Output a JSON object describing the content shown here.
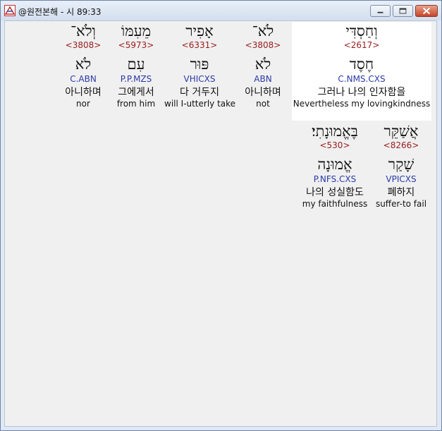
{
  "window": {
    "title": "@원전본해 - 시 89:33"
  },
  "rows": [
    {
      "words": [
        {
          "hebrew": "וְחַסְדִּי",
          "strong": "<2617>",
          "lemma": "חֶסֶד",
          "parse": "C.NMS.CXS",
          "korean": "그러나 나의 인자함을",
          "english": "Nevertheless my lovingkindness",
          "selected": true
        },
        {
          "hebrew": "לֹא־",
          "strong": "<3808>",
          "lemma": "לֹא",
          "parse": "ABN",
          "korean": "아니하며",
          "english": "not",
          "selected": false
        },
        {
          "hebrew": "אָפִיר",
          "strong": "<6331>",
          "lemma": "פּוּר",
          "parse": "VHICXS",
          "korean": "다 거두지",
          "english": "will I-utterly take",
          "selected": false
        },
        {
          "hebrew": "מֵעִמּוֹ",
          "strong": "<5973>",
          "lemma": "עִם",
          "parse": "P.P.MZS",
          "korean": "그에게서",
          "english": "from him",
          "selected": false
        },
        {
          "hebrew": "וְלֹא־",
          "strong": "<3808>",
          "lemma": "לֹא",
          "parse": "C.ABN",
          "korean": "아니하며",
          "english": "nor",
          "selected": false
        }
      ]
    },
    {
      "words": [
        {
          "hebrew": "אֲשַׁקֵּר",
          "strong": "<8266>",
          "lemma": "שָׁקַר",
          "parse": "VPICXS",
          "korean": "폐하지",
          "english": "suffer-to fail",
          "selected": false
        },
        {
          "hebrew": "בֶּאֱמוּנָתִי׃",
          "strong": "<530>",
          "lemma": "אֱמוּנָה",
          "parse": "P.NFS.CXS",
          "korean": "나의 성실함도",
          "english": "my faithfulness",
          "selected": false
        }
      ]
    }
  ]
}
